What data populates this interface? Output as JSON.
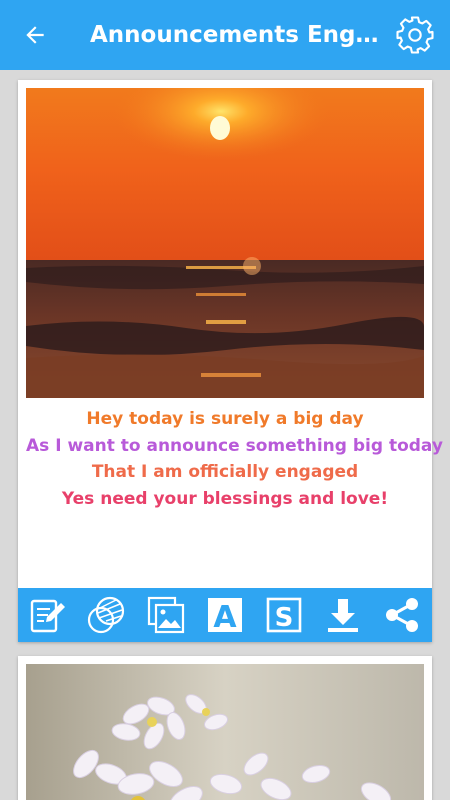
{
  "appbar": {
    "title": "Announcements Engagement Messages"
  },
  "cards": [
    {
      "message_lines": [
        "Hey today is surely a big day",
        "As I want to announce something big today",
        "That I am officially engaged",
        "Yes need your blessings and love!"
      ],
      "message_colors": [
        "#f07a2a",
        "#b85ad9",
        "#ef6b4a",
        "#e8406a"
      ],
      "toolbar_color": "#2fa5f2",
      "toolbar_icons": [
        "edit-icon",
        "color-palette-icon",
        "gallery-icon",
        "font-icon",
        "style-icon",
        "download-icon",
        "share-icon"
      ]
    }
  ],
  "colors": {
    "accent": "#2fa5f2",
    "background": "#d9d9d9"
  }
}
